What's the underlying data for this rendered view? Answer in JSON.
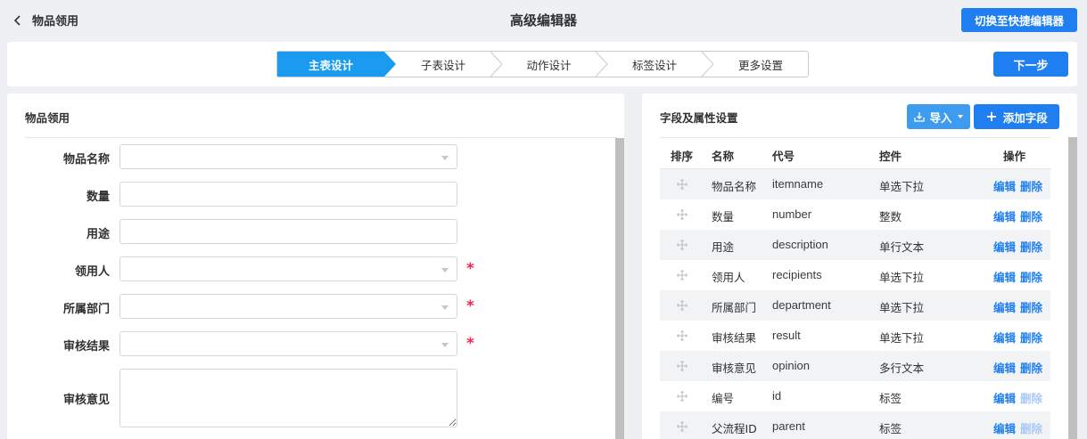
{
  "header": {
    "back_label": "物品领用",
    "title": "高级编辑器",
    "switch_button": "切换至快捷编辑器"
  },
  "steps": {
    "items": [
      {
        "label": "主表设计",
        "active": true
      },
      {
        "label": "子表设计",
        "active": false
      },
      {
        "label": "动作设计",
        "active": false
      },
      {
        "label": "标签设计",
        "active": false
      },
      {
        "label": "更多设置",
        "active": false
      }
    ],
    "next_button": "下一步"
  },
  "form": {
    "title": "物品领用",
    "fields": [
      {
        "label": "物品名称",
        "type": "select",
        "required": false,
        "value": ""
      },
      {
        "label": "数量",
        "type": "input",
        "required": false,
        "value": ""
      },
      {
        "label": "用途",
        "type": "input",
        "required": false,
        "value": ""
      },
      {
        "label": "领用人",
        "type": "select",
        "required": true,
        "value": ""
      },
      {
        "label": "所属部门",
        "type": "select",
        "required": true,
        "value": ""
      },
      {
        "label": "审核结果",
        "type": "select",
        "required": true,
        "value": ""
      },
      {
        "label": "审核意见",
        "type": "textarea",
        "required": false,
        "value": ""
      }
    ],
    "required_mark": "*"
  },
  "field_panel": {
    "title": "字段及属性设置",
    "import_button": "导入",
    "add_button": "添加字段",
    "columns": {
      "order": "排序",
      "name": "名称",
      "code": "代号",
      "control": "控件",
      "actions": "操作"
    },
    "edit_label": "编辑",
    "delete_label": "删除",
    "rows": [
      {
        "name": "物品名称",
        "code": "itemname",
        "control": "单选下拉",
        "deletable": true
      },
      {
        "name": "数量",
        "code": "number",
        "control": "整数",
        "deletable": true
      },
      {
        "name": "用途",
        "code": "description",
        "control": "单行文本",
        "deletable": true
      },
      {
        "name": "领用人",
        "code": "recipients",
        "control": "单选下拉",
        "deletable": true
      },
      {
        "name": "所属部门",
        "code": "department",
        "control": "单选下拉",
        "deletable": true
      },
      {
        "name": "审核结果",
        "code": "result",
        "control": "单选下拉",
        "deletable": true
      },
      {
        "name": "审核意见",
        "code": "opinion",
        "control": "多行文本",
        "deletable": true
      },
      {
        "name": "编号",
        "code": "id",
        "control": "标签",
        "deletable": false
      },
      {
        "name": "父流程ID",
        "code": "parent",
        "control": "标签",
        "deletable": false
      }
    ]
  },
  "colors": {
    "primary": "#1f7ff0",
    "import_button": "#3d9cf0",
    "active_step": "#1a9bf0",
    "required": "#f0294d",
    "disabled_link": "#a9c9f5"
  }
}
